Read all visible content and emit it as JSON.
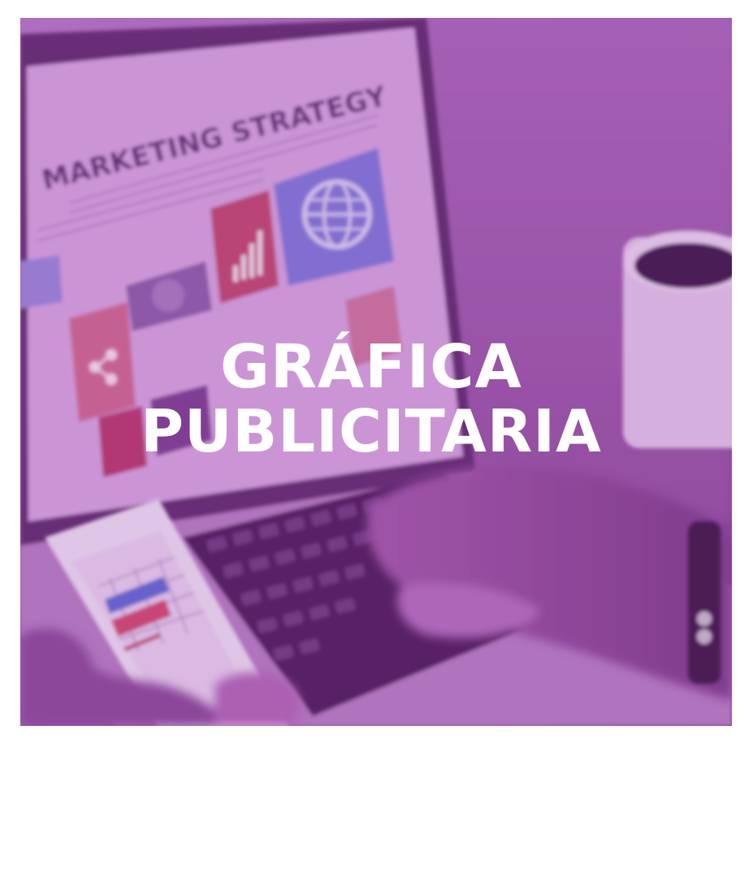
{
  "card": {
    "title_line1": "GRÁFICA",
    "title_line2": "PUBLICITARIA",
    "tint_color": "#9a4fab"
  },
  "photo": {
    "screen_heading": "MARKETING STRATEGY"
  }
}
